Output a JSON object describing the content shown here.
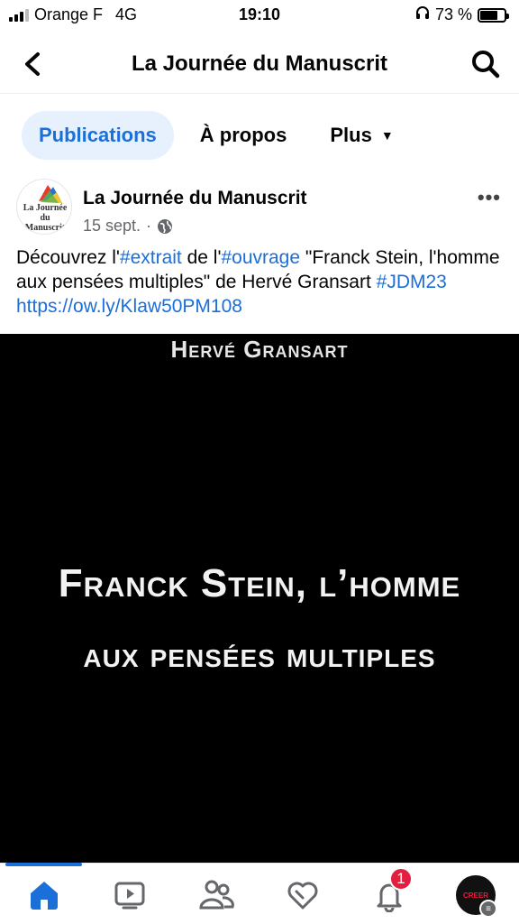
{
  "status_bar": {
    "carrier": "Orange F",
    "network": "4G",
    "time": "19:10",
    "battery": "73 %",
    "battery_level": 0.73
  },
  "header": {
    "title": "La Journée du Manuscrit",
    "back_icon": "chevron-left-icon",
    "search_icon": "search-icon"
  },
  "tabs": [
    {
      "label": "Publications",
      "active": true
    },
    {
      "label": "À propos",
      "active": false
    },
    {
      "label": "Plus",
      "active": false
    }
  ],
  "post": {
    "page_name": "La Journée du Manuscrit",
    "logo_text": "La Journée du Manuscrit",
    "date": "15 sept.",
    "separator": "·",
    "text_parts": [
      "Découvrez l'",
      "#extrait",
      " de l'",
      "#ouvrage",
      " \"Franck Stein, l'homme aux pensées multiples\" de Hervé Gransart ",
      "#JDM23",
      " ",
      "https://ow.ly/Klaw50PM108"
    ],
    "video": {
      "author": "Hervé Gransart",
      "title_line1": "Franck Stein, l’homme",
      "title_line2": "aux pensées multiples"
    }
  },
  "bottom_nav": {
    "notifications_badge": "1",
    "profile_text": "CREER",
    "items": [
      "home-icon",
      "video-icon",
      "friends-icon",
      "dating-heart-icon",
      "bell-icon",
      "profile-avatar"
    ]
  },
  "colors": {
    "accent": "#1b6fd8",
    "tab_active_bg": "#e7f0fd",
    "badge": "#e41e3f",
    "meta_text": "#65676b"
  }
}
